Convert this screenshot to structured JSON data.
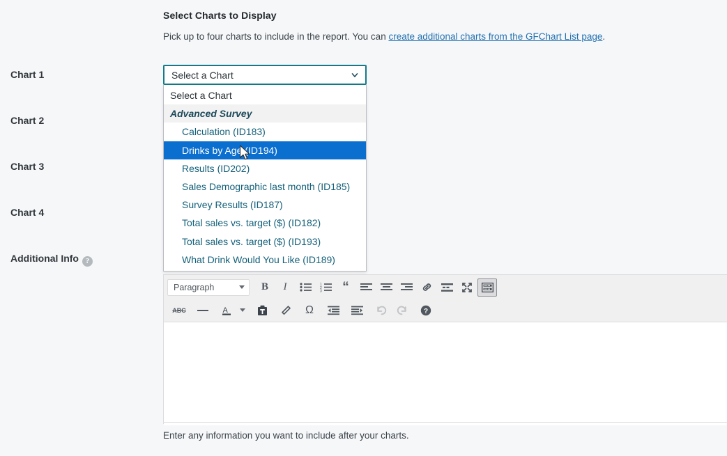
{
  "section": {
    "title": "Select Charts to Display",
    "description_before": "Pick up to four charts to include in the report. You can ",
    "description_link": "create additional charts from the GFChart List page",
    "description_after": "."
  },
  "labels": {
    "chart1": "Chart 1",
    "chart2": "Chart 2",
    "chart3": "Chart 3",
    "chart4": "Chart 4",
    "additional_info": "Additional Info",
    "help_icon": "?"
  },
  "select": {
    "value": "Select a Chart",
    "open": true,
    "focus_border_color": "#127a8a",
    "highlight_color": "#0b6fd0",
    "options": [
      {
        "label": "Select a Chart",
        "type": "placeholder",
        "selected": false
      },
      {
        "label": "Advanced Survey",
        "type": "group",
        "selected": false
      },
      {
        "label": "Calculation (ID183)",
        "type": "option",
        "selected": false
      },
      {
        "label": "Drinks by Age (ID194)",
        "type": "option",
        "selected": true
      },
      {
        "label": "Results (ID202)",
        "type": "option",
        "selected": false
      },
      {
        "label": "Sales Demographic last month (ID185)",
        "type": "option",
        "selected": false
      },
      {
        "label": "Survey Results (ID187)",
        "type": "option",
        "selected": false
      },
      {
        "label": "Total sales vs. target ($) (ID182)",
        "type": "option",
        "selected": false
      },
      {
        "label": "Total sales vs. target ($) (ID193)",
        "type": "option",
        "selected": false
      },
      {
        "label": "What Drink Would You Like (ID189)",
        "type": "option",
        "selected": false
      }
    ]
  },
  "editor": {
    "format_select": "Paragraph",
    "content": "",
    "toolbar_row1": [
      {
        "name": "bold-icon",
        "label": "B"
      },
      {
        "name": "italic-icon",
        "label": "I"
      },
      {
        "name": "bulleted-list-icon",
        "label": ""
      },
      {
        "name": "numbered-list-icon",
        "label": ""
      },
      {
        "name": "blockquote-icon",
        "label": "“"
      },
      {
        "name": "align-left-icon",
        "label": ""
      },
      {
        "name": "align-center-icon",
        "label": ""
      },
      {
        "name": "align-right-icon",
        "label": ""
      },
      {
        "name": "link-icon",
        "label": ""
      },
      {
        "name": "read-more-icon",
        "label": ""
      },
      {
        "name": "fullscreen-icon",
        "label": ""
      },
      {
        "name": "toolbar-toggle-icon",
        "label": "",
        "active": true
      }
    ],
    "toolbar_row2": [
      {
        "name": "strikethrough-icon",
        "label": "ABC"
      },
      {
        "name": "horizontal-rule-icon",
        "label": ""
      },
      {
        "name": "text-color-icon",
        "label": "A"
      },
      {
        "name": "text-color-dropdown-icon",
        "label": ""
      },
      {
        "name": "paste-as-text-icon",
        "label": ""
      },
      {
        "name": "clear-formatting-icon",
        "label": ""
      },
      {
        "name": "special-character-icon",
        "label": "Ω"
      },
      {
        "name": "outdent-icon",
        "label": ""
      },
      {
        "name": "indent-icon",
        "label": ""
      },
      {
        "name": "undo-icon",
        "label": "",
        "disabled": true
      },
      {
        "name": "redo-icon",
        "label": "",
        "disabled": true
      },
      {
        "name": "keyboard-shortcuts-icon",
        "label": "?"
      }
    ]
  },
  "footer": {
    "note": "Enter any information you want to include after your charts."
  }
}
